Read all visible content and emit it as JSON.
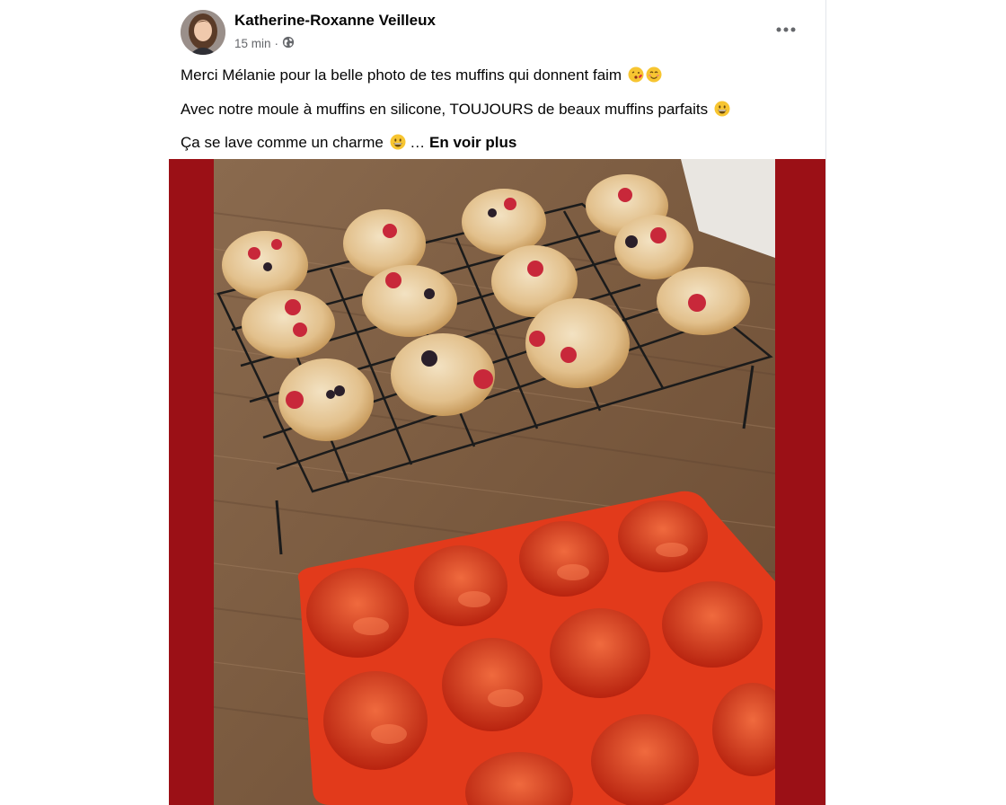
{
  "post": {
    "author": "Katherine-Roxanne Veilleux",
    "time": "15 min",
    "separator": "·",
    "lines": [
      "Merci Mélanie pour la belle photo de tes muffins qui donnent faim",
      "Avec notre moule à muffins en silicone, TOUJOURS de beaux muffins parfaits",
      "Ça se lave comme un charme"
    ],
    "ellipsis": "…",
    "see_more": "En voir plus"
  },
  "icons": {
    "privacy": "globe-icon",
    "more": "more-horizontal-icon"
  },
  "colors": {
    "photo_background": "#9b1016",
    "silicone_mold": "#e23a1b"
  }
}
